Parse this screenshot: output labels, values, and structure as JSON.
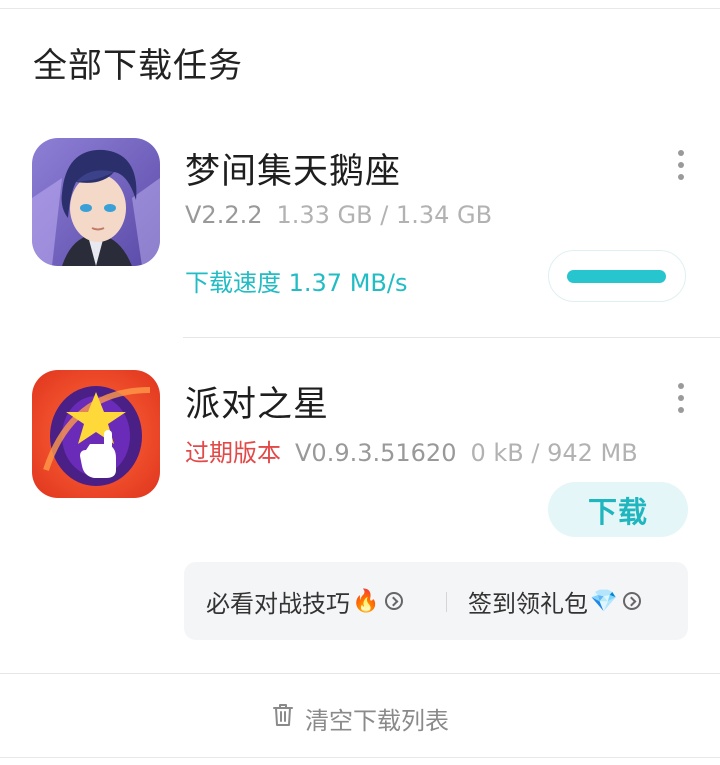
{
  "section": {
    "title": "全部下载任务"
  },
  "tasks": [
    {
      "name": "梦间集天鹅座",
      "version": "V2.2.2",
      "size": "1.33 GB / 1.34 GB",
      "status": "下载速度 1.37 MB/s",
      "progress": 0.99,
      "icon": "anime-character-icon"
    },
    {
      "name": "派对之星",
      "tag": "过期版本",
      "version": "V0.9.3.51620",
      "size": "0 kB / 942 MB",
      "action": "下载",
      "icon": "star-game-icon"
    }
  ],
  "promo": {
    "items": [
      {
        "label": "必看对战技巧",
        "emoji": "🔥"
      },
      {
        "label": "签到领礼包",
        "emoji": "💎"
      }
    ]
  },
  "footer": {
    "clear_label": "清空下载列表"
  },
  "colors": {
    "accent": "#22bcc4",
    "expired": "#e24a4a",
    "progress": "#27c6cf"
  }
}
